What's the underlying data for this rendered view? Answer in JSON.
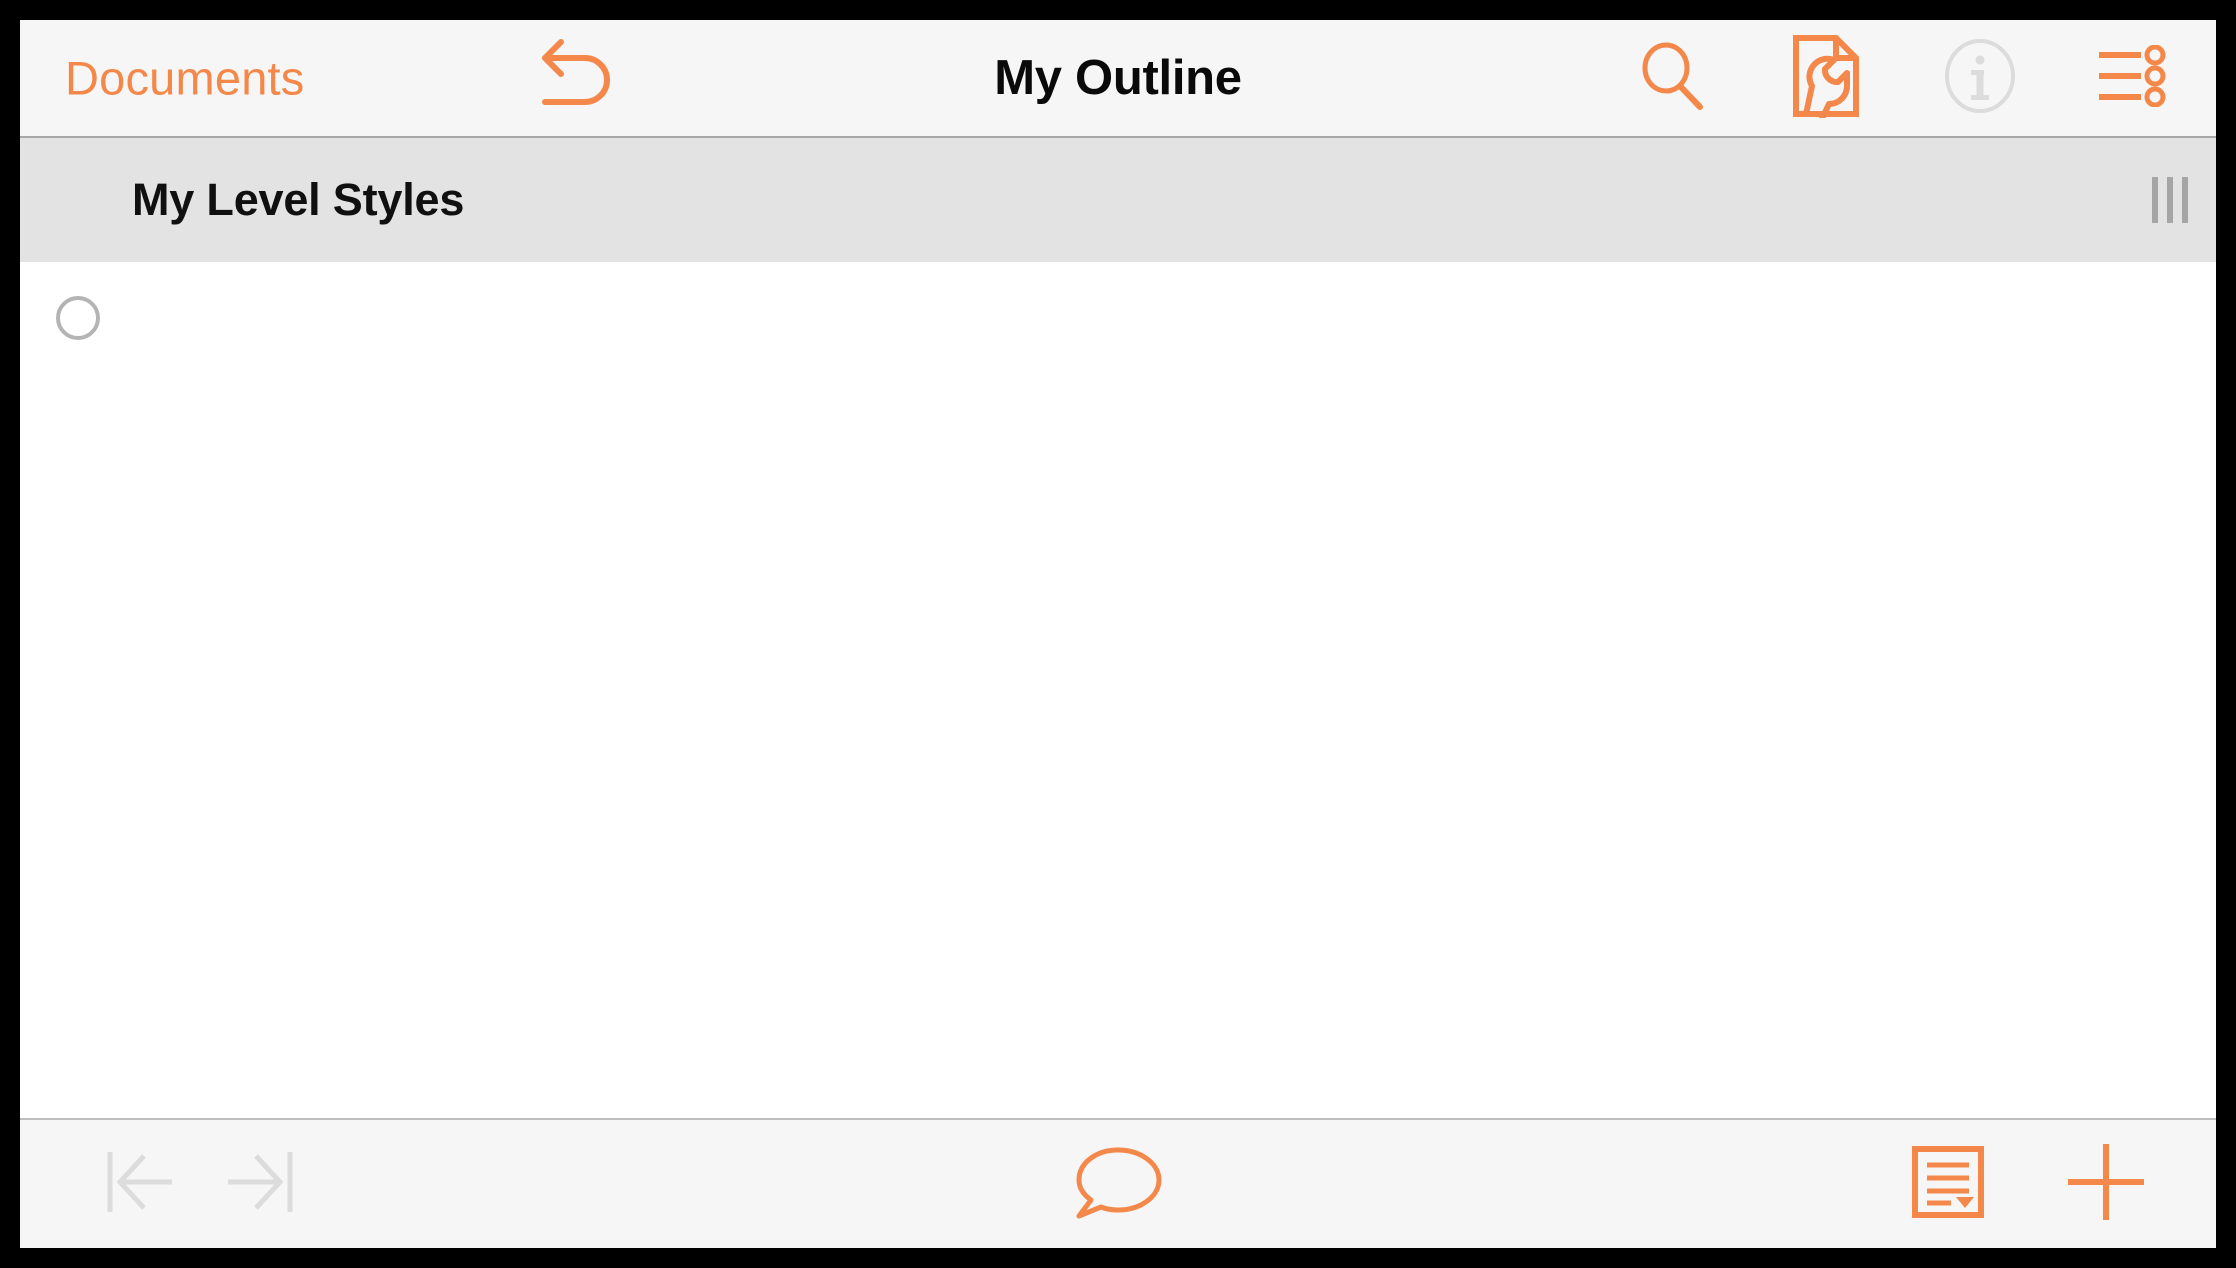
{
  "colors": {
    "accent": "#F4884A",
    "nav_background": "#F6F6F6",
    "section_header_background": "#E3E3E3",
    "content_background": "#FFFFFF",
    "disabled_grey": "#DCDCDC",
    "bullet_grey": "#B4B4B4",
    "frame_border": "#000000"
  },
  "nav": {
    "back_label": "Documents",
    "title": "My Outline",
    "undo_icon": "undo-arrow-icon",
    "right_items": [
      {
        "name": "search-icon",
        "label": "Search",
        "enabled": true
      },
      {
        "name": "document-wrench-icon",
        "label": "Document Settings",
        "enabled": true
      },
      {
        "name": "info-circle-icon",
        "label": "Info",
        "enabled": false
      },
      {
        "name": "outline-levels-icon",
        "label": "Contents",
        "enabled": true
      }
    ]
  },
  "section_header": {
    "title": "My Level Styles",
    "drag_handle_icon": "column-drag-handle-icon"
  },
  "outline": {
    "rows": [
      {
        "bullet_icon": "circle-bullet-icon",
        "text": ""
      }
    ],
    "row_placeholder": ""
  },
  "bottom_toolbar": {
    "items": [
      {
        "name": "outdent-icon",
        "label": "Outdent",
        "enabled": false
      },
      {
        "name": "indent-icon",
        "label": "Indent",
        "enabled": false
      },
      {
        "name": "note-bubble-icon",
        "label": "Note",
        "enabled": true
      },
      {
        "name": "styles-list-icon",
        "label": "Styles",
        "enabled": true
      },
      {
        "name": "plus-icon",
        "label": "Add Row",
        "enabled": true
      }
    ]
  }
}
